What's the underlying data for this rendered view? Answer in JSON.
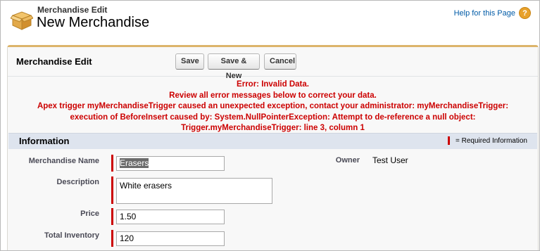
{
  "header": {
    "subtitle": "Merchandise Edit",
    "title": "New Merchandise",
    "help_link": "Help for this Page",
    "help_icon": "?"
  },
  "panel": {
    "title": "Merchandise Edit",
    "buttons": {
      "save": "Save",
      "save_new": "Save & New",
      "cancel": "Cancel"
    }
  },
  "errors": [
    "Error: Invalid Data.",
    "Review all error messages below to correct your data.",
    "Apex trigger myMerchandiseTrigger caused an unexpected exception, contact your administrator: myMerchandiseTrigger:",
    "execution of BeforeInsert caused by: System.NullPointerException: Attempt to de-reference a null object:",
    "Trigger.myMerchandiseTrigger: line 3, column 1"
  ],
  "section": {
    "title": "Information",
    "required_legend": "= Required Information"
  },
  "fields": {
    "merchandise_name": {
      "label": "Merchandise Name",
      "value": "Erasers"
    },
    "description": {
      "label": "Description",
      "value": "White erasers"
    },
    "price": {
      "label": "Price",
      "value": "1.50"
    },
    "total_inventory": {
      "label": "Total Inventory",
      "value": "120"
    },
    "owner": {
      "label": "Owner",
      "value": "Test User"
    }
  },
  "colors": {
    "error": "#cc0000",
    "required": "#cc0000",
    "section_bar": "#dee4ee",
    "panel_accent": "#dcb46a",
    "link": "#015ba7"
  }
}
